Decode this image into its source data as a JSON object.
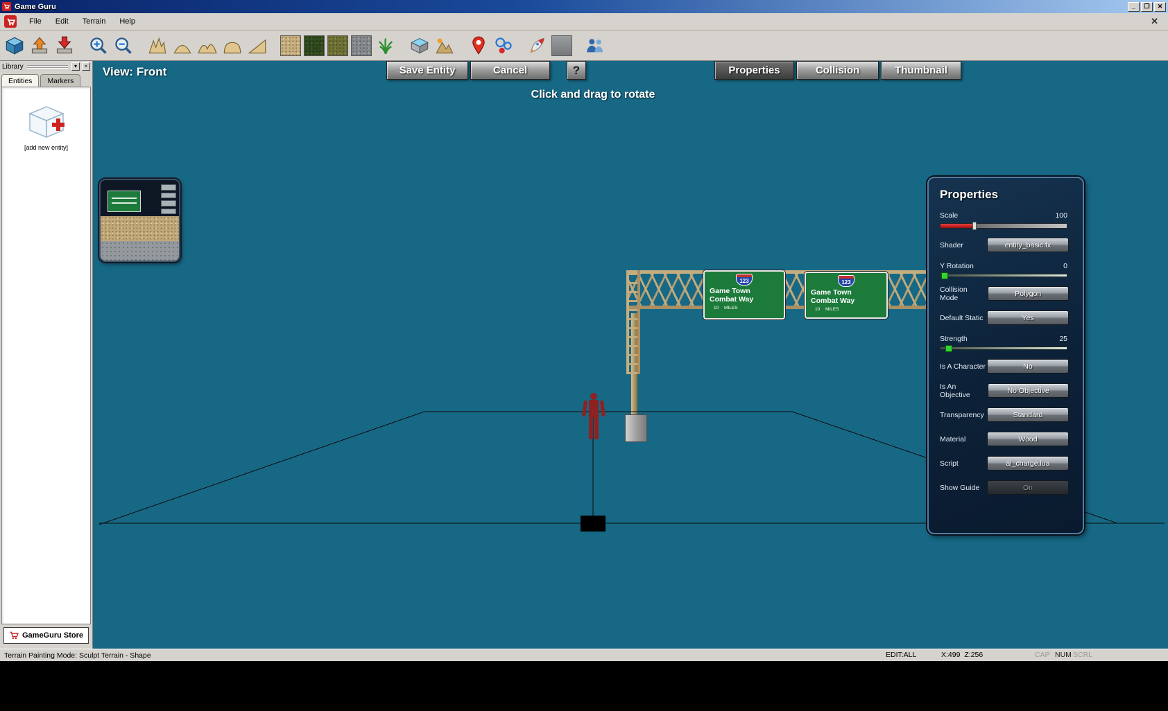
{
  "window": {
    "title": "Game Guru",
    "minimize": "_",
    "maximize": "❐",
    "close": "✕"
  },
  "menu_bar": {
    "items": [
      "File",
      "Edit",
      "Terrain",
      "Help"
    ],
    "close": "✕"
  },
  "toolbar": {
    "icons": [
      "new-entity",
      "load-entity",
      "save-entity",
      "zoom-in",
      "zoom-out",
      "terrain-raise",
      "terrain-hill",
      "terrain-ridge",
      "terrain-dome",
      "terrain-ramp",
      "texture-gravel",
      "texture-forest",
      "texture-grass",
      "texture-rock",
      "vegetation-grass",
      "water-block",
      "mountains",
      "position-marker",
      "entity-orbs",
      "rocket-test",
      "empty-slot",
      "characters"
    ]
  },
  "library": {
    "title": "Library",
    "shade_button": "▾",
    "close_button": "×",
    "tabs": [
      {
        "label": "Entities",
        "active": true
      },
      {
        "label": "Markers",
        "active": false
      }
    ],
    "add_new_entity_label": "[add new entity]",
    "store_button": "GameGuru Store"
  },
  "viewport": {
    "view_label": "View: Front",
    "rotate_hint": "Click and drag to rotate",
    "save_button": "Save Entity",
    "cancel_button": "Cancel",
    "help_button": "?",
    "tabs": [
      {
        "label": "Properties",
        "active": true
      },
      {
        "label": "Collision",
        "active": false
      },
      {
        "label": "Thumbnail",
        "active": false
      }
    ],
    "sign": {
      "shield": "123",
      "line1": "Game Town",
      "line2": "Combat Way",
      "line3": "10 MILES"
    }
  },
  "properties_panel": {
    "title": "Properties",
    "rows": [
      {
        "label": "Scale",
        "value": "100",
        "control": "slider-red",
        "fill_percent": 27
      },
      {
        "label": "Shader",
        "button": "entity_basic.fx"
      },
      {
        "label": "Y Rotation",
        "value": "0",
        "control": "slider-green",
        "fill_percent": 1
      },
      {
        "label": "Collision Mode",
        "button": "Polygon"
      },
      {
        "label": "Default Static",
        "button": "Yes"
      },
      {
        "label": "Strength",
        "value": "25",
        "control": "slider-green",
        "fill_percent": 4
      },
      {
        "label": "Is A Character",
        "button": "No"
      },
      {
        "label": "Is An Objective",
        "button": "No Objective"
      },
      {
        "label": "Transparency",
        "button": "Standard"
      },
      {
        "label": "Material",
        "button": "Wood"
      },
      {
        "label": "Script",
        "button": "ai_charge.lua"
      },
      {
        "label": "Show Guide",
        "button": "On",
        "pressed": true
      }
    ],
    "colors": {
      "scale_fill": "#cc2222",
      "slider_handle_green": "#35d435",
      "panel_border": "#517ca3"
    }
  },
  "status_bar": {
    "mode_text": "Terrain Painting Mode: Sculpt Terrain - Shape",
    "edit_text": "EDIT:ALL",
    "coords_text": "X:499 Z:256",
    "indicators": [
      {
        "label": "CAP",
        "active": false
      },
      {
        "label": "NUM",
        "active": true
      },
      {
        "label": "SCRL",
        "active": false
      }
    ]
  }
}
